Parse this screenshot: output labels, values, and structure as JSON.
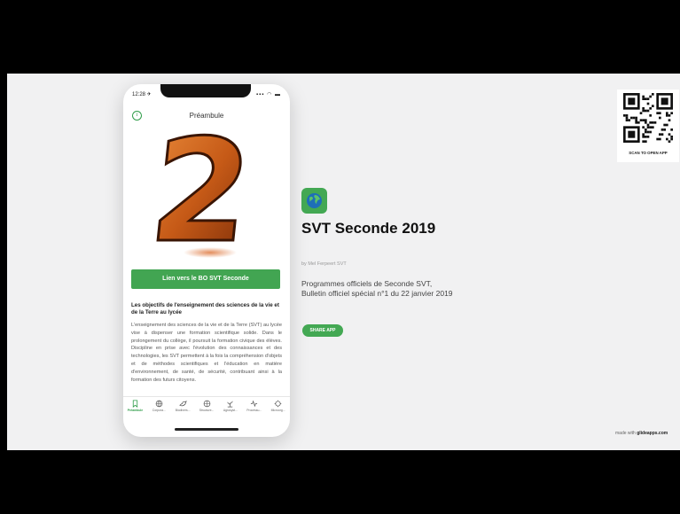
{
  "phone": {
    "status_time": "12:28 ✈",
    "status_icons": "▪▪▪ ◠ ▬",
    "screen_title": "Préambule",
    "hero_digit": "2",
    "link_button": "Lien vers le BO SVT Seconde",
    "section_heading": "Les objectifs de l'enseignement des sciences de la vie et de la Terre au lycée",
    "body_text": "L'enseignement des sciences de la vie et de la Terre (SVT) au lycée vise à dispenser une formation scientifique solide. Dans le prolongement du collège, il poursuit la formation civique des élèves. Discipline en prise avec l'évolution des connaissances et des technologies, les SVT permettent à la fois la compréhension d'objets et de méthodes scientifiques et l'éducation en matière d'environnement, de santé, de sécurité, contribuant ainsi à la formation des futurs citoyens.",
    "tabs": [
      {
        "label": "Préambule",
        "icon": "bookmark-icon",
        "active": true
      },
      {
        "label": "Corpora...",
        "icon": "globe-icon",
        "active": false
      },
      {
        "label": "Biodivers...",
        "icon": "bird-icon",
        "active": false
      },
      {
        "label": "Structure...",
        "icon": "globe-icon",
        "active": false
      },
      {
        "label": "Agrosyst...",
        "icon": "plant-icon",
        "active": false
      },
      {
        "label": "Processu...",
        "icon": "pulse-icon",
        "active": false
      },
      {
        "label": "Microorg...",
        "icon": "virus-icon",
        "active": false
      }
    ]
  },
  "app": {
    "icon": "earth-icon",
    "name": "SVT Seconde 2019",
    "byline": "by Mel Ferpeert SVT",
    "description": "Programmes officiels de Seconde SVT, Bulletin officiel spécial n°1 du 22 janvier 2019",
    "share_label": "SHARE APP"
  },
  "qr": {
    "caption": "SCAN TO OPEN APP"
  },
  "footer": {
    "made_with_prefix": "made with ",
    "made_with_brand": "glideapps.com"
  },
  "colors": {
    "accent_green": "#43a853",
    "digit_orange": "#c9611b",
    "background": "#f1f1f2"
  }
}
